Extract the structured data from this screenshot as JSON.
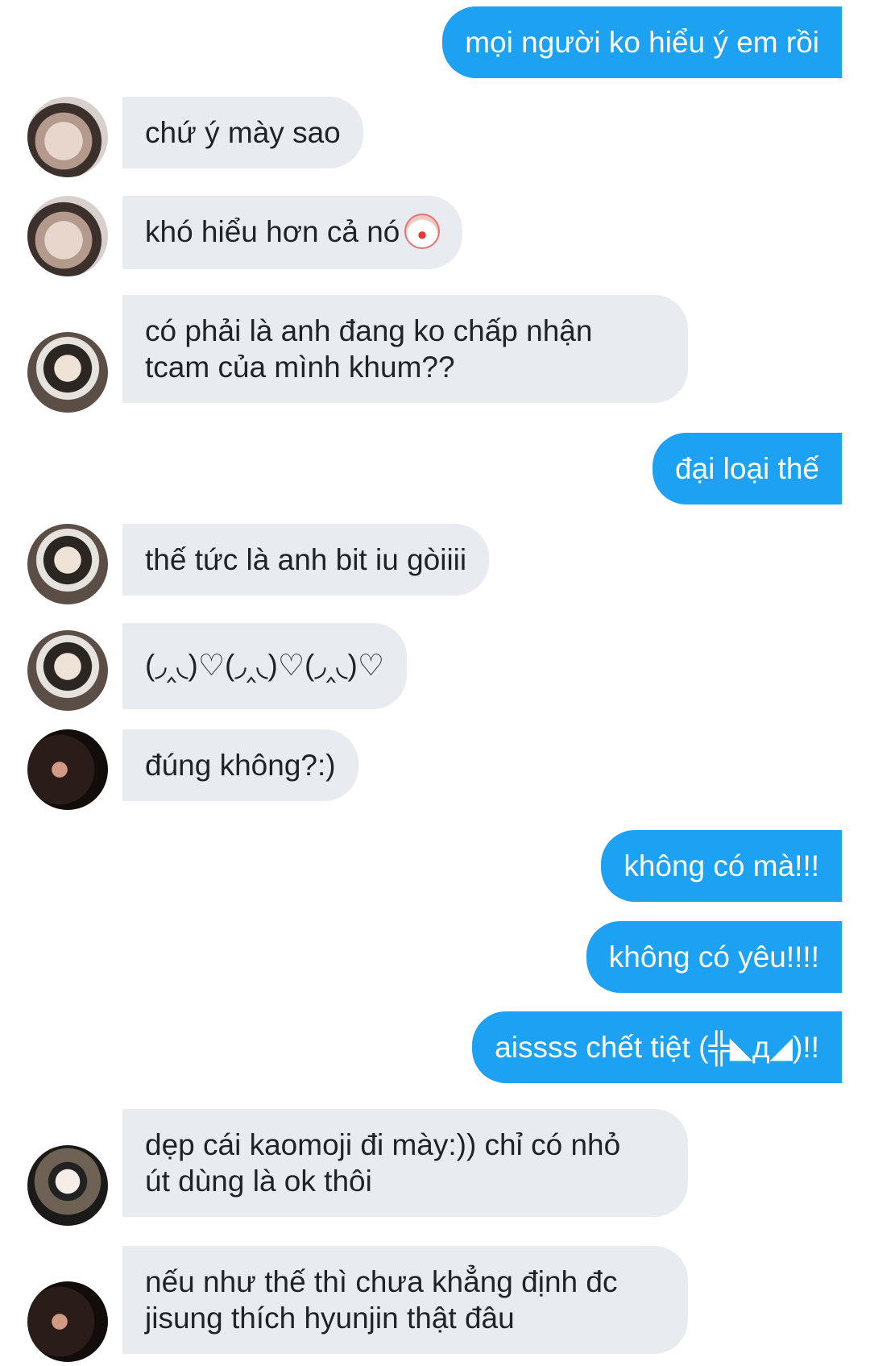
{
  "messages": [
    {
      "side": "out",
      "lines": [
        "mọi người ko hiểu ý em rồi"
      ]
    },
    {
      "side": "in",
      "avatar": "a",
      "lines": [
        "chứ ý mày sao"
      ]
    },
    {
      "side": "in",
      "avatar": "a",
      "lines": [
        "khó hiểu hơn cả nó"
      ],
      "icon": "clown-face-icon"
    },
    {
      "side": "in",
      "avatar": "b",
      "lines": [
        "có phải là anh đang ko chấp nhận",
        "tcam của mình khum??"
      ]
    },
    {
      "side": "out",
      "lines": [
        "đại loại thế"
      ]
    },
    {
      "side": "in",
      "avatar": "b",
      "lines": [
        "thế tức là anh bit iu gòiiii"
      ]
    },
    {
      "side": "in",
      "avatar": "b",
      "lines": [
        "(◞‸◟)♡(◞‸◟)♡(◞‸◟)♡"
      ]
    },
    {
      "side": "in",
      "avatar": "c",
      "lines": [
        "đúng không?:)"
      ]
    },
    {
      "side": "out",
      "lines": [
        "không có mà!!!"
      ]
    },
    {
      "side": "out",
      "lines": [
        "không có yêu!!!!"
      ]
    },
    {
      "side": "out",
      "lines": [
        "aissss chết tiệt (╬◣д◢)!!"
      ]
    },
    {
      "side": "in",
      "avatar": "d",
      "lines": [
        "dẹp cái kaomoji đi mày:)) chỉ có nhỏ",
        "út dùng là ok thôi"
      ]
    },
    {
      "side": "in",
      "avatar": "c",
      "lines": [
        "nếu như thế thì chưa khẳng định đc",
        "jisung thích hyunjin thật đâu"
      ]
    }
  ]
}
